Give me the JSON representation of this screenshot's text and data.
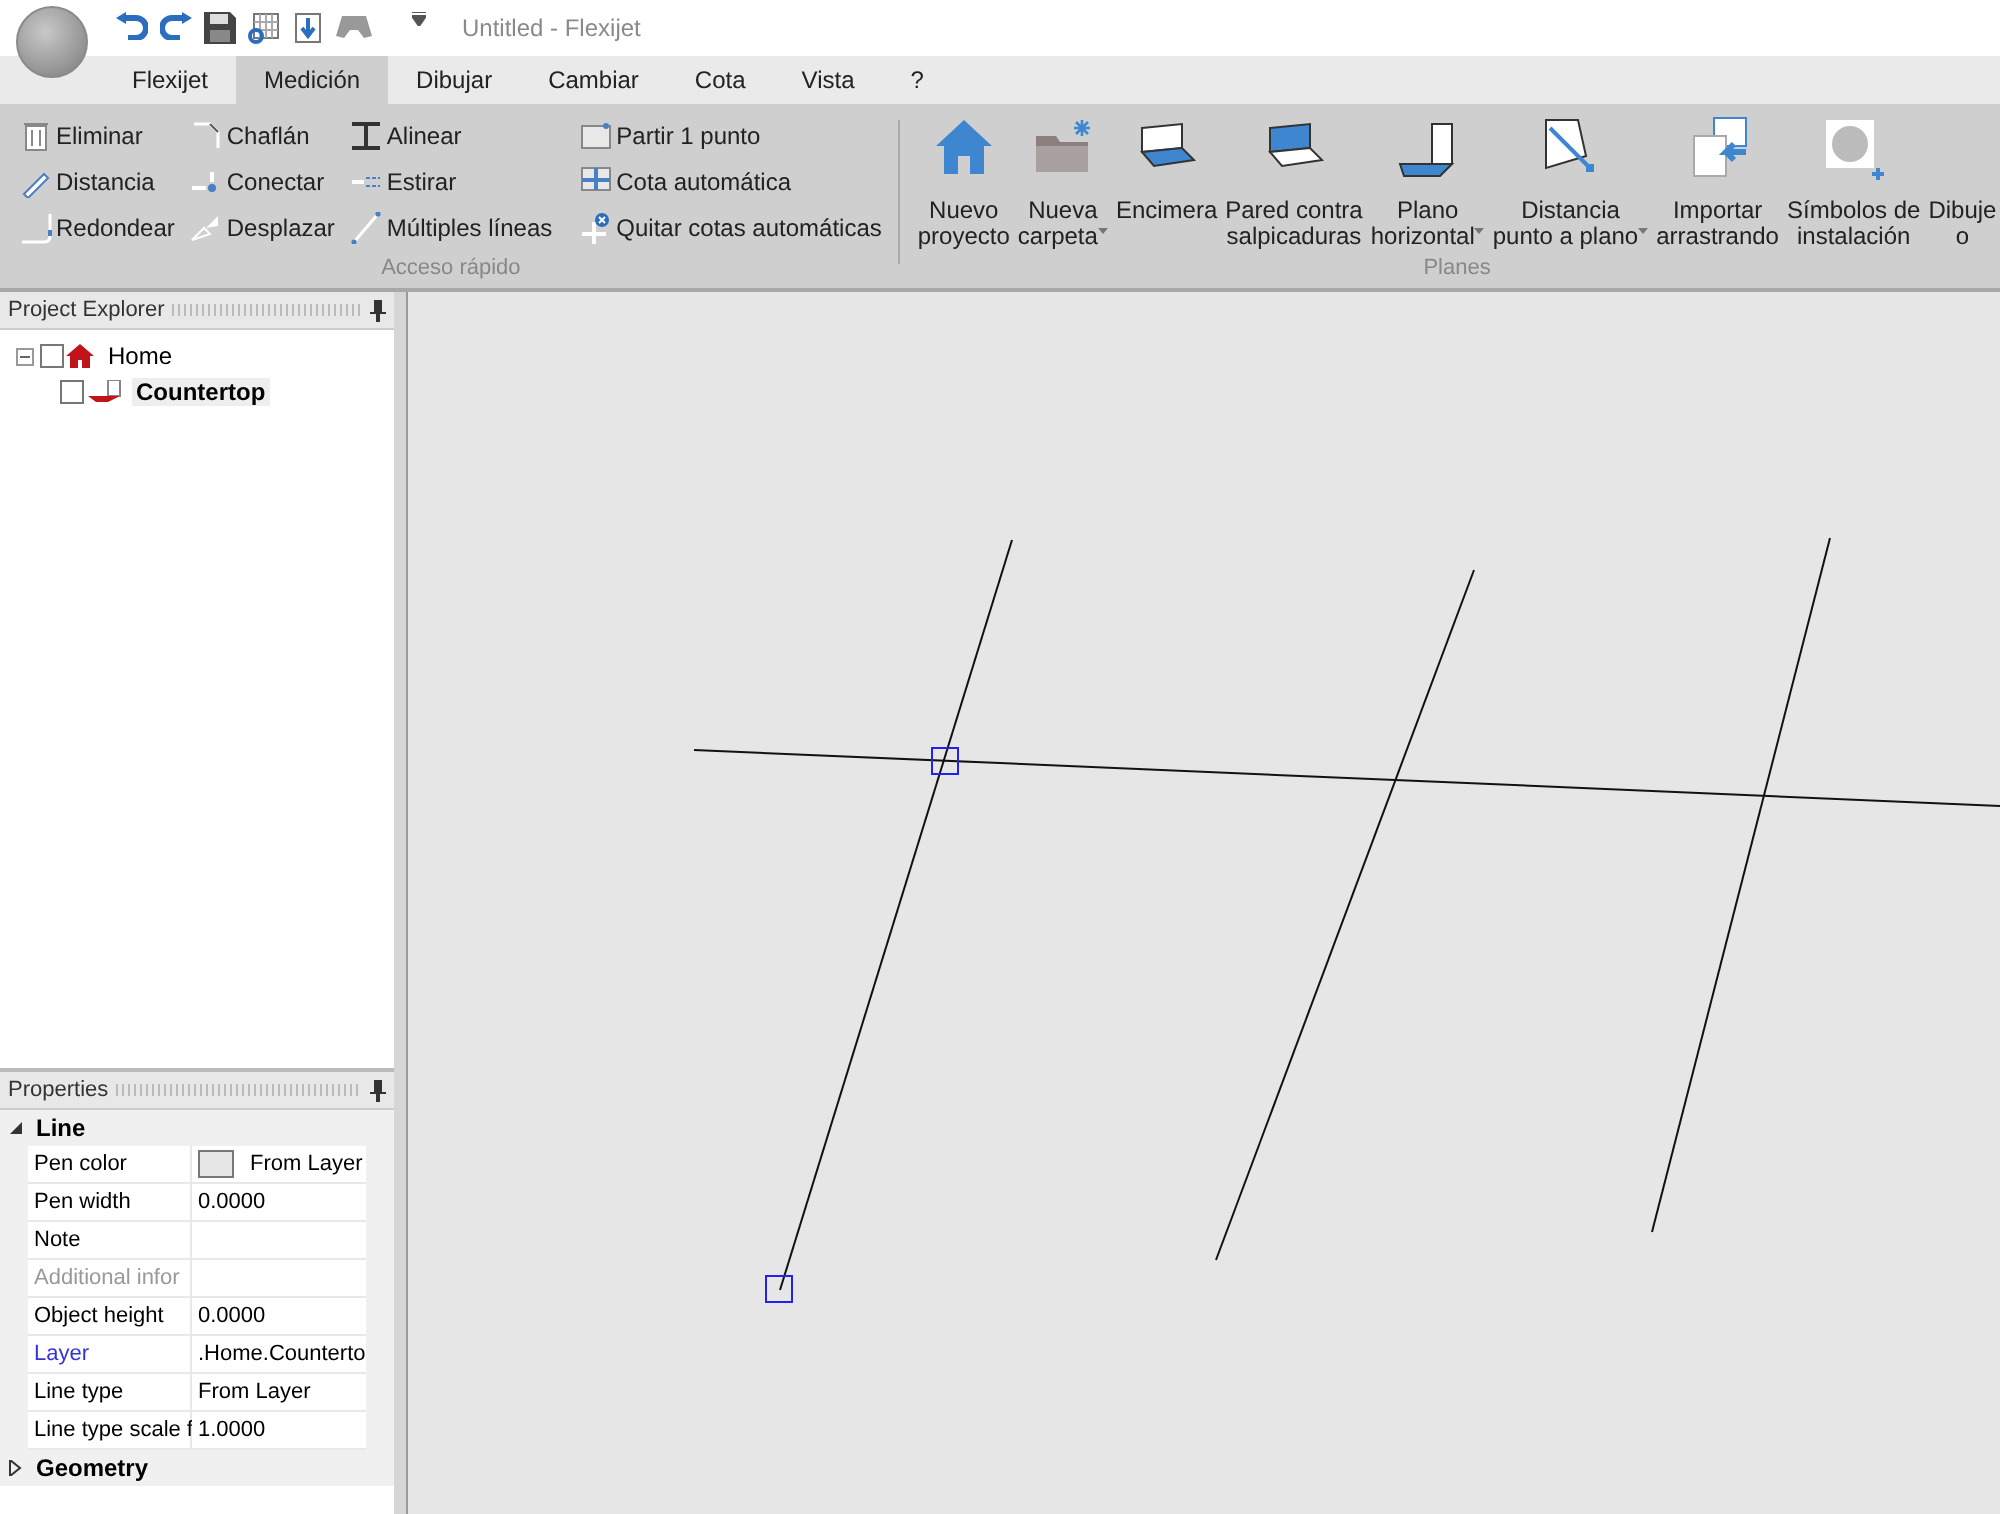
{
  "window": {
    "title": "Untitled -  Flexijet"
  },
  "tabs": [
    {
      "label": "Flexijet",
      "selected": false
    },
    {
      "label": "Medición",
      "selected": true
    },
    {
      "label": "Dibujar",
      "selected": false
    },
    {
      "label": "Cambiar",
      "selected": false
    },
    {
      "label": "Cota",
      "selected": false
    },
    {
      "label": "Vista",
      "selected": false
    },
    {
      "label": "?",
      "selected": false
    }
  ],
  "ribbon": {
    "groups": [
      {
        "label": "Acceso rápido",
        "kind": "small",
        "items": [
          {
            "label": "Eliminar"
          },
          {
            "label": "Distancia"
          },
          {
            "label": "Redondear"
          },
          {
            "label": "Chaflán"
          },
          {
            "label": "Conectar"
          },
          {
            "label": "Desplazar"
          },
          {
            "label": "Alinear"
          },
          {
            "label": "Estirar"
          },
          {
            "label": "Múltiples líneas"
          },
          {
            "label": "Partir 1 punto"
          },
          {
            "label": "Cota automática"
          },
          {
            "label": "Quitar cotas automáticas"
          }
        ]
      },
      {
        "label": "Planes",
        "kind": "large",
        "items": [
          {
            "label": "Nuevo\nproyecto",
            "dropdown": false
          },
          {
            "label": "Nueva\ncarpeta",
            "dropdown": true
          },
          {
            "label": "Encimera",
            "dropdown": false
          },
          {
            "label": "Pared contra\nsalpicaduras",
            "dropdown": false
          },
          {
            "label": "Plano\nhorizontal",
            "dropdown": true
          },
          {
            "label": "Distancia\npunto a plano",
            "dropdown": true
          },
          {
            "label": "Importar\narrastrando",
            "dropdown": false
          },
          {
            "label": "Símbolos de\ninstalación",
            "dropdown": false
          },
          {
            "label": "Dibuje\no",
            "dropdown": false
          }
        ]
      }
    ]
  },
  "project_explorer": {
    "title": "Project Explorer",
    "tree": [
      {
        "label": "Home",
        "expanded": true,
        "checked": false,
        "selected": false,
        "children": [
          {
            "label": "Countertop",
            "checked": false,
            "selected": true
          }
        ]
      }
    ]
  },
  "properties": {
    "title": "Properties",
    "categories": [
      {
        "label": "Line",
        "expanded": true,
        "rows": [
          {
            "name": "Pen color",
            "value": "From Layer",
            "kind": "color"
          },
          {
            "name": "Pen width",
            "value": "0.0000",
            "kind": "text"
          },
          {
            "name": "Note",
            "kind": "text"
          },
          {
            "name": "Additional infor",
            "kind": "disabled"
          },
          {
            "name": "Object height",
            "value": "0.0000",
            "kind": "text"
          },
          {
            "name": "Layer",
            "value": ".Home.Counterto",
            "kind": "link"
          },
          {
            "name": "Line type",
            "value": "From Layer",
            "kind": "text"
          },
          {
            "name": "Line type scale f",
            "value": "1.0000",
            "kind": "text"
          }
        ]
      },
      {
        "label": "Geometry",
        "expanded": false
      }
    ]
  }
}
